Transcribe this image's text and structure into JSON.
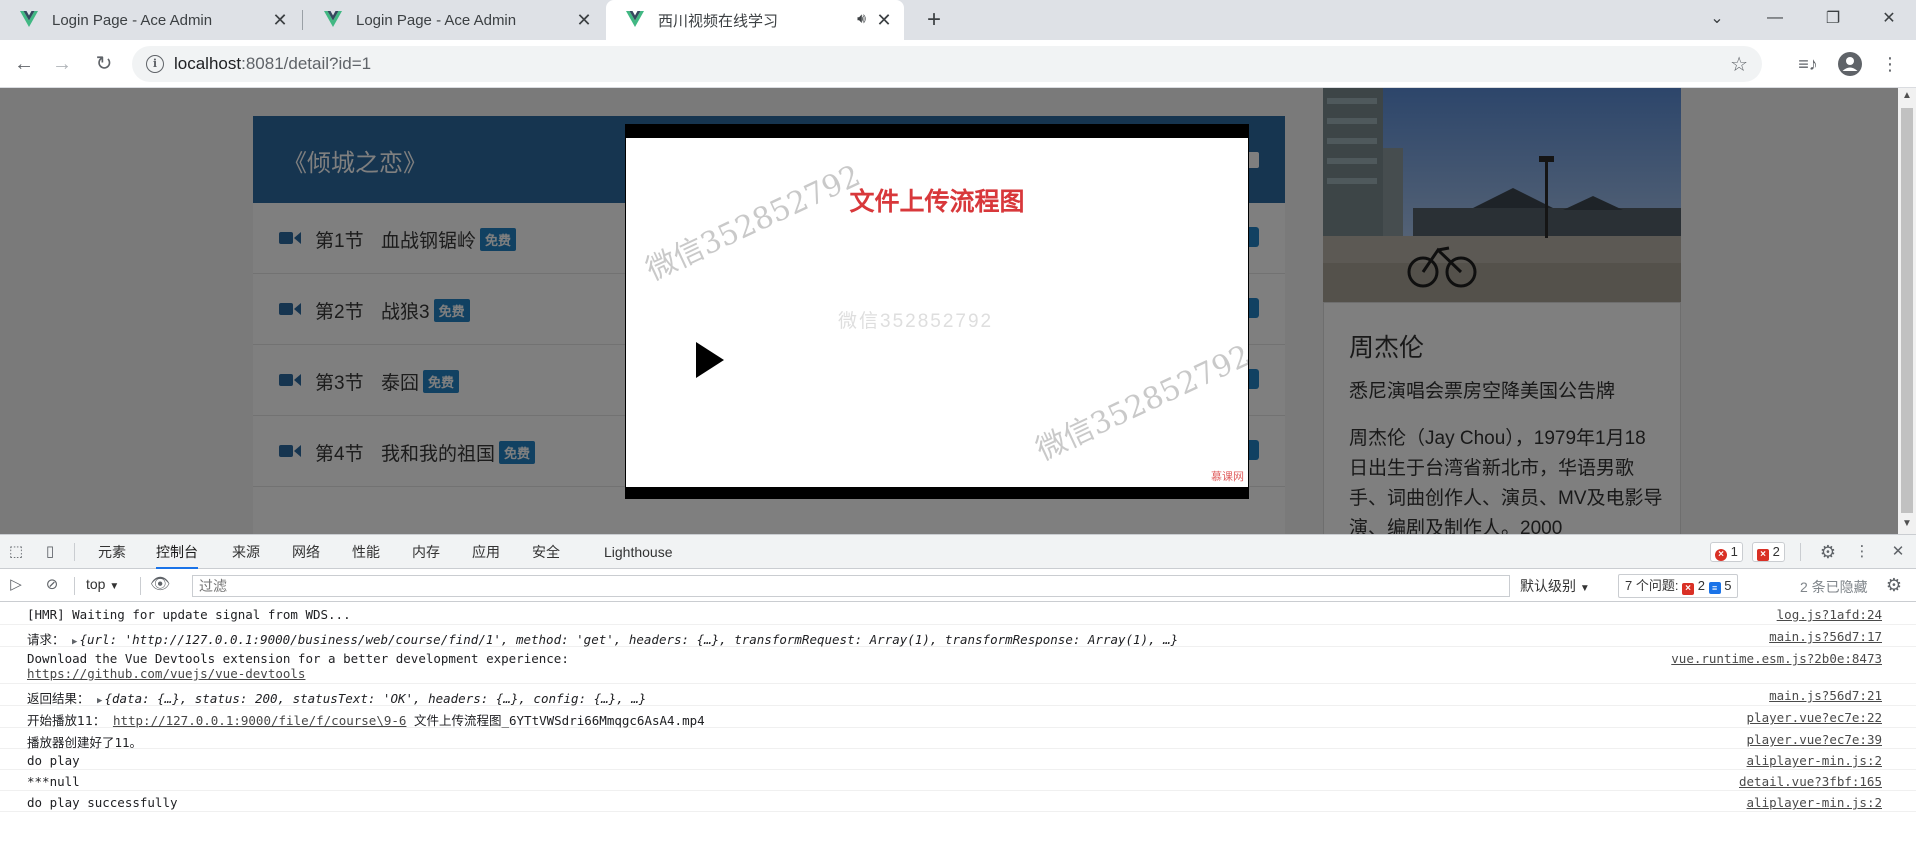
{
  "browser": {
    "tabs": [
      {
        "title": "Login Page - Ace Admin"
      },
      {
        "title": "Login Page - Ace Admin"
      },
      {
        "title": "西川视频在线学习"
      }
    ],
    "url_host": "localhost",
    "url_path": ":8081/detail?id=1"
  },
  "page": {
    "course_title": "《倾城之恋》",
    "free_label": "免费",
    "sections": [
      {
        "no": "第1节",
        "name": "血战钢锯岭"
      },
      {
        "no": "第2节",
        "name": "战狼3"
      },
      {
        "no": "第3节",
        "name": "泰囧"
      },
      {
        "no": "第4节",
        "name": "我和我的祖国"
      }
    ],
    "teacher": {
      "name": "周杰伦",
      "motto": "悉尼演唱会票房空降美国公告牌",
      "intro": "周杰伦（Jay Chou），1979年1月18日出生于台湾省新北市，华语男歌手、词曲创作人、演员、MV及电影导演、编剧及制作人。2000"
    },
    "video": {
      "slide_title": "文件上传流程图",
      "watermark_top": "微信352852792",
      "watermark_center": "微信352852792",
      "watermark_bottom": "微信352852792",
      "corner_logo": "慕课网"
    }
  },
  "devtools": {
    "tabs": [
      "元素",
      "控制台",
      "来源",
      "网络",
      "性能",
      "内存",
      "应用",
      "安全",
      "Lighthouse"
    ],
    "error_count": "1",
    "issue_count": "2",
    "context": "top",
    "filter_placeholder": "过滤",
    "level": "默认级别",
    "issues_label": "7 个问题:",
    "issues_errors": "2",
    "issues_info": "5",
    "hidden_label": "2 条已隐藏",
    "logs": [
      {
        "text": "[HMR] Waiting for update signal from WDS...",
        "source": "log.js?1afd:24"
      },
      {
        "prefix": "请求：",
        "obj": "{url: 'http://127.0.0.1:9000/business/web/course/find/1', method: 'get', headers: {…}, transformRequest: Array(1), transformResponse: Array(1), …}",
        "source": "main.js?56d7:17"
      },
      {
        "text": "Download the Vue Devtools extension for a better development experience:",
        "link": "https://github.com/vuejs/vue-devtools",
        "source": "vue.runtime.esm.js?2b0e:8473"
      },
      {
        "prefix": "返回结果：",
        "obj": "{data: {…}, status: 200, statusText: 'OK', headers: {…}, config: {…}, …}",
        "source": "main.js?56d7:21"
      },
      {
        "prefix": "开始播放11：",
        "link": "http://127.0.0.1:9000/file/f/course\\9-6",
        "suffix": " 文件上传流程图_6YTtVWSdri66Mmqgc6AsA4.mp4",
        "source": "player.vue?ec7e:22"
      },
      {
        "text": "播放器创建好了11。",
        "source": "player.vue?ec7e:39"
      },
      {
        "text": "do play",
        "source": "aliplayer-min.js:2"
      },
      {
        "text": "***null",
        "source": "detail.vue?3fbf:165"
      },
      {
        "text": "do play successfully",
        "source": "aliplayer-min.js:2"
      }
    ]
  }
}
